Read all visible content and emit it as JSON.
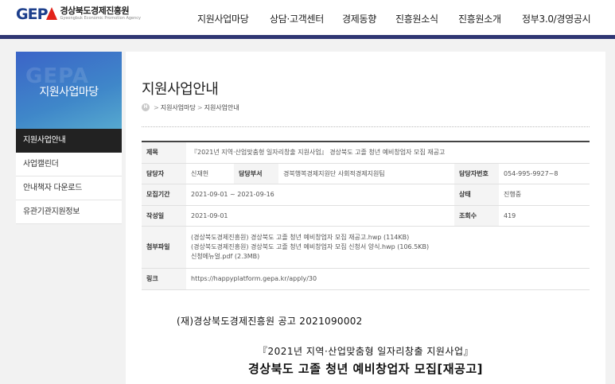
{
  "header": {
    "logo_mark": "GEP",
    "logo_name_ko": "경상북도경제진흥원",
    "logo_name_en": "Gyeongbuk Economic Promotion Agency",
    "nav": [
      "지원사업마당",
      "상담·고객센터",
      "경제동향",
      "진흥원소식",
      "진흥원소개",
      "정부3.0/경영공시"
    ]
  },
  "sidebar": {
    "title": "지원사업마당",
    "watermark": "GEPA",
    "items": [
      "지원사업안내",
      "사업캘린더",
      "안내책자 다운로드",
      "유관기관지원정보"
    ],
    "active_index": 0
  },
  "page": {
    "title": "지원사업안내",
    "breadcrumb": [
      "지원사업마당",
      "지원사업안내"
    ]
  },
  "detail": {
    "subject_label": "제목",
    "subject": "『2021년 지역·산업맞춤형 일자리창출 지원사업』 경상북도 고졸 청년 예비창업자 모집 재공고",
    "manager_label": "담당자",
    "manager": "신재헌",
    "dept_label": "담당부서",
    "dept": "경북행복경제지원단 사회적경제지원팀",
    "phone_label": "담당자번호",
    "phone": "054-995-9927~8",
    "period_label": "모집기간",
    "period": "2021-09-01 ~ 2021-09-16",
    "status_label": "상태",
    "status": "진행중",
    "created_label": "작성일",
    "created": "2021-09-01",
    "views_label": "조회수",
    "views": "419",
    "attach_label": "첨부파일",
    "attachments": [
      "(경상북도경제진흥원) 경상북도 고졸 청년 예비창업자 모집 재공고.hwp (114KB)",
      "(경상북도경제진흥원) 경상북도 고졸 청년 예비창업자 모집 신청서 양식.hwp (106.5KB)",
      "신청메뉴얼.pdf (2.3MB)"
    ],
    "link_label": "링크",
    "link": "https://happyplatform.gepa.kr/apply/30"
  },
  "notice": {
    "line1": "(재)경상북도경제진흥원 공고 2021090002",
    "line2": "『2021년 지역·산업맞춤형 일자리창출 지원사업』",
    "line3": "경상북도 고졸 청년 예비창업자 모집[재공고]"
  }
}
